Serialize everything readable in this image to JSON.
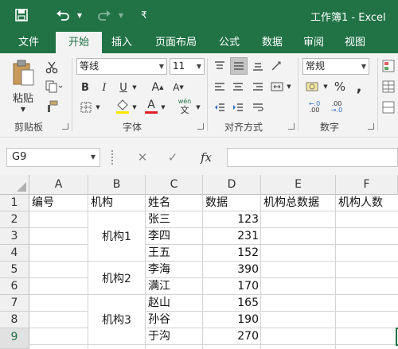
{
  "app": {
    "title": "工作簿1 - Excel"
  },
  "quick_access": {
    "save_icon": "save-icon",
    "undo_icon": "undo-icon",
    "redo_icon": "redo-icon",
    "customize_glyph": "₹"
  },
  "tabs": [
    {
      "label": "文件"
    },
    {
      "label": "开始"
    },
    {
      "label": "插入"
    },
    {
      "label": "页面布局"
    },
    {
      "label": "公式"
    },
    {
      "label": "数据"
    },
    {
      "label": "审阅"
    },
    {
      "label": "视图"
    }
  ],
  "ribbon": {
    "clipboard": {
      "paste_label": "粘贴",
      "group_label": "剪贴板"
    },
    "font": {
      "font_name": "等线",
      "font_size": "11",
      "bold": "B",
      "italic": "I",
      "underline": "U",
      "grow": "A",
      "shrink": "A",
      "font_color_glyph": "A",
      "wen": "wén",
      "wen_char": "文",
      "group_label": "字体"
    },
    "alignment": {
      "group_label": "对齐方式"
    },
    "number": {
      "format": "常规",
      "percent": "%",
      "comma": ",",
      "group_label": "数字"
    }
  },
  "formula_bar": {
    "name_box": "G9",
    "cancel": "✕",
    "enter": "✓",
    "fx": "fx",
    "formula": ""
  },
  "sheet": {
    "columns": [
      "A",
      "B",
      "C",
      "D",
      "E",
      "F"
    ],
    "rows": [
      "1",
      "2",
      "3",
      "4",
      "5",
      "6",
      "7",
      "8",
      "9"
    ],
    "selected_row": "9",
    "headers": {
      "A": "编号",
      "B": "机构",
      "C": "姓名",
      "D": "数据",
      "E": "机构总数据",
      "F": "机构人数"
    },
    "records": [
      {
        "name": "张三",
        "value": "123"
      },
      {
        "name": "李四",
        "value": "231"
      },
      {
        "name": "王五",
        "value": "152"
      },
      {
        "name": "李海",
        "value": "390"
      },
      {
        "name": "满江",
        "value": "170"
      },
      {
        "name": "赵山",
        "value": "165"
      },
      {
        "name": "孙谷",
        "value": "190"
      },
      {
        "name": "于沟",
        "value": "270"
      }
    ],
    "groups": [
      "机构1",
      "机构2",
      "机构3"
    ]
  },
  "colors": {
    "excel_green": "#217346",
    "font_color_bar": "#e02020",
    "fill_color_bar": "#ffe600"
  }
}
